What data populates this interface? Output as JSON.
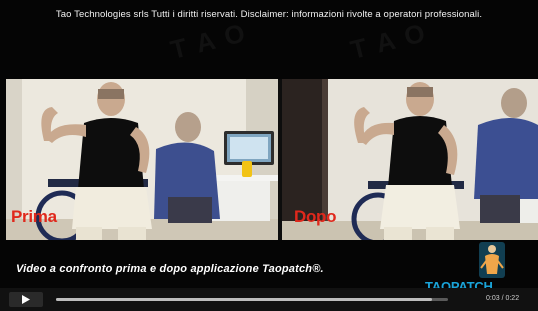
{
  "disclaimer": "Tao Technologies srls Tutti i diritti riservati. Disclaimer: informazioni rivolte a operatori professionali.",
  "video": {
    "label_before": "Prima",
    "label_after": "Dopo",
    "caption": "Video a confronto prima e dopo applicazione Taopatch®.",
    "progress": 0.96,
    "time": "0:03 / 0:22"
  },
  "brand": {
    "logo_text": "TAOPATCH",
    "logo_icon": "taopatch-logo",
    "colors": {
      "label_red": "#e0281c",
      "logo_blue": "#1aa3d8"
    }
  },
  "controls": {
    "play_icon": "play-icon"
  }
}
